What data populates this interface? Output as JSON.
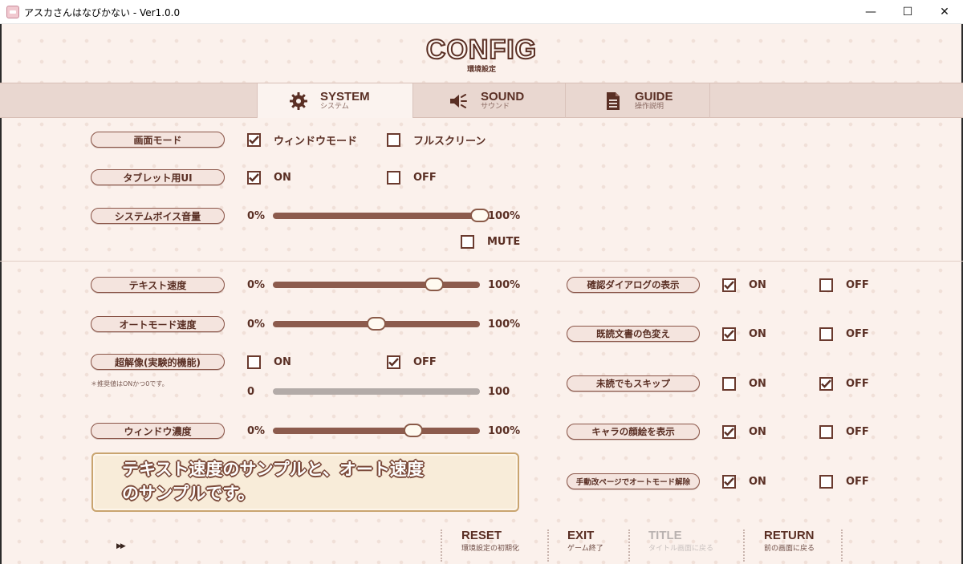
{
  "window": {
    "title": "アスカさんはなびかない - Ver1.0.0",
    "minimize_glyph": "—",
    "maximize_glyph": "☐",
    "close_glyph": "✕"
  },
  "header": {
    "title": "CONFIG",
    "subtitle": "環境設定"
  },
  "tabs": [
    {
      "label": "SYSTEM",
      "sub": "システム",
      "icon": "gear-icon",
      "active": true
    },
    {
      "label": "SOUND",
      "sub": "サウンド",
      "icon": "speaker-icon",
      "active": false
    },
    {
      "label": "GUIDE",
      "sub": "操作説明",
      "icon": "document-icon",
      "active": false
    }
  ],
  "system": {
    "screen_mode": {
      "label": "画面モード",
      "options": [
        "ウィンドウモード",
        "フルスクリーン"
      ],
      "checked": [
        true,
        false
      ]
    },
    "tablet_ui": {
      "label": "タブレット用UI",
      "options": [
        "ON",
        "OFF"
      ],
      "checked": [
        true,
        false
      ]
    },
    "voice_volume": {
      "label": "システムボイス音量",
      "min": "0%",
      "max": "100%",
      "value": 1.0,
      "mute_label": "MUTE",
      "mute_checked": false
    }
  },
  "left": {
    "text_speed": {
      "label": "テキスト速度",
      "min": "0%",
      "max": "100%",
      "value": 0.78
    },
    "auto_speed": {
      "label": "オートモード速度",
      "min": "0%",
      "max": "100%",
      "value": 0.5
    },
    "super_res": {
      "label": "超解像(実験的機能)",
      "options": [
        "ON",
        "OFF"
      ],
      "checked": [
        false,
        true
      ],
      "note": "＊推奨値はONかつ0です。",
      "min": "0",
      "max": "100"
    },
    "window_opacity": {
      "label": "ウィンドウ濃度",
      "min": "0%",
      "max": "100%",
      "value": 0.68
    }
  },
  "right": [
    {
      "label": "確認ダイアログの表示",
      "on": "ON",
      "off": "OFF",
      "checked": [
        true,
        false
      ]
    },
    {
      "label": "既読文書の色変え",
      "on": "ON",
      "off": "OFF",
      "checked": [
        true,
        false
      ]
    },
    {
      "label": "未読でもスキップ",
      "on": "ON",
      "off": "OFF",
      "checked": [
        false,
        true
      ]
    },
    {
      "label": "キャラの顔絵を表示",
      "on": "ON",
      "off": "OFF",
      "checked": [
        true,
        false
      ]
    },
    {
      "label": "手動改ページでオートモード解除",
      "on": "ON",
      "off": "OFF",
      "checked": [
        true,
        false
      ]
    }
  ],
  "sample": {
    "line1": "テキスト速度のサンプルと、オート速度",
    "line2": "のサンプルです。"
  },
  "skip_glyph": "▶▶",
  "nav": [
    {
      "label": "RESET",
      "sub": "環境設定の初期化",
      "enabled": true
    },
    {
      "label": "EXIT",
      "sub": "ゲーム終了",
      "enabled": true
    },
    {
      "label": "TITLE",
      "sub": "タイトル画面に戻る",
      "enabled": false
    },
    {
      "label": "RETURN",
      "sub": "前の画面に戻る",
      "enabled": true
    }
  ],
  "colors": {
    "accent": "#5a2f24",
    "slider_track": "#8c5b4d",
    "background": "#fbf1ec",
    "sample_border": "#c9a46f"
  }
}
